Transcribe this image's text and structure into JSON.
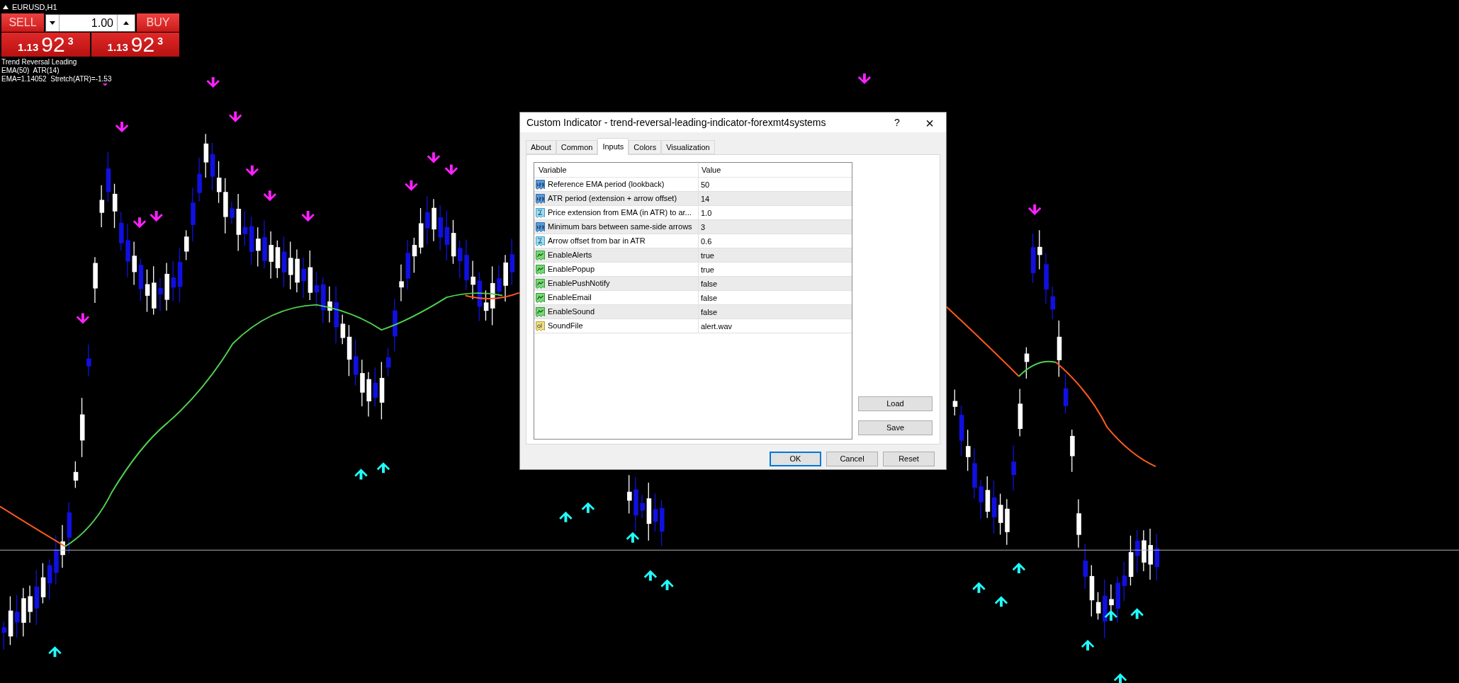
{
  "chart_title": "EURUSD,H1",
  "trade_panel": {
    "sell_label": "SELL",
    "buy_label": "BUY",
    "lot": "1.00",
    "sell_price": {
      "prefix": "1.13",
      "pips": "92",
      "point": "3"
    },
    "buy_price": {
      "prefix": "1.13",
      "pips": "92",
      "point": "3"
    }
  },
  "indicator_lines": [
    "Trend Reversal Leading",
    "EMA(50)  ATR(14)",
    "EMA=1.14052  Stretch(ATR)=-1.53"
  ],
  "dialog": {
    "title": "Custom Indicator - trend-reversal-leading-indicator-forexmt4systems",
    "help": "?",
    "close": "×",
    "tabs": [
      {
        "label": "About",
        "selected": false
      },
      {
        "label": "Common",
        "selected": false
      },
      {
        "label": "Inputs",
        "selected": true
      },
      {
        "label": "Colors",
        "selected": false
      },
      {
        "label": "Visualization",
        "selected": false
      }
    ],
    "columns": [
      "Variable",
      "Value"
    ],
    "rows": [
      {
        "kind": "int",
        "variable": "Reference EMA period (lookback)",
        "value": "50"
      },
      {
        "kind": "int",
        "variable": "ATR period (extension + arrow offset)",
        "value": "14"
      },
      {
        "kind": "double",
        "variable": "Price extension from EMA (in ATR) to ar...",
        "value": "1.0"
      },
      {
        "kind": "int",
        "variable": "Minimum bars between same-side arrows",
        "value": "3"
      },
      {
        "kind": "double",
        "variable": "Arrow offset from bar in ATR",
        "value": "0.6"
      },
      {
        "kind": "bool",
        "variable": "EnableAlerts",
        "value": "true"
      },
      {
        "kind": "bool",
        "variable": "EnablePopup",
        "value": "true"
      },
      {
        "kind": "bool",
        "variable": "EnablePushNotify",
        "value": "false"
      },
      {
        "kind": "bool",
        "variable": "EnableEmail",
        "value": "false"
      },
      {
        "kind": "bool",
        "variable": "EnableSound",
        "value": "false"
      },
      {
        "kind": "string",
        "variable": "SoundFile",
        "value": "alert.wav"
      }
    ],
    "side_buttons": [
      "Load",
      "Save"
    ],
    "buttons": [
      {
        "label": "OK",
        "default": true
      },
      {
        "label": "Cancel",
        "default": false
      },
      {
        "label": "Reset",
        "default": false
      }
    ]
  }
}
